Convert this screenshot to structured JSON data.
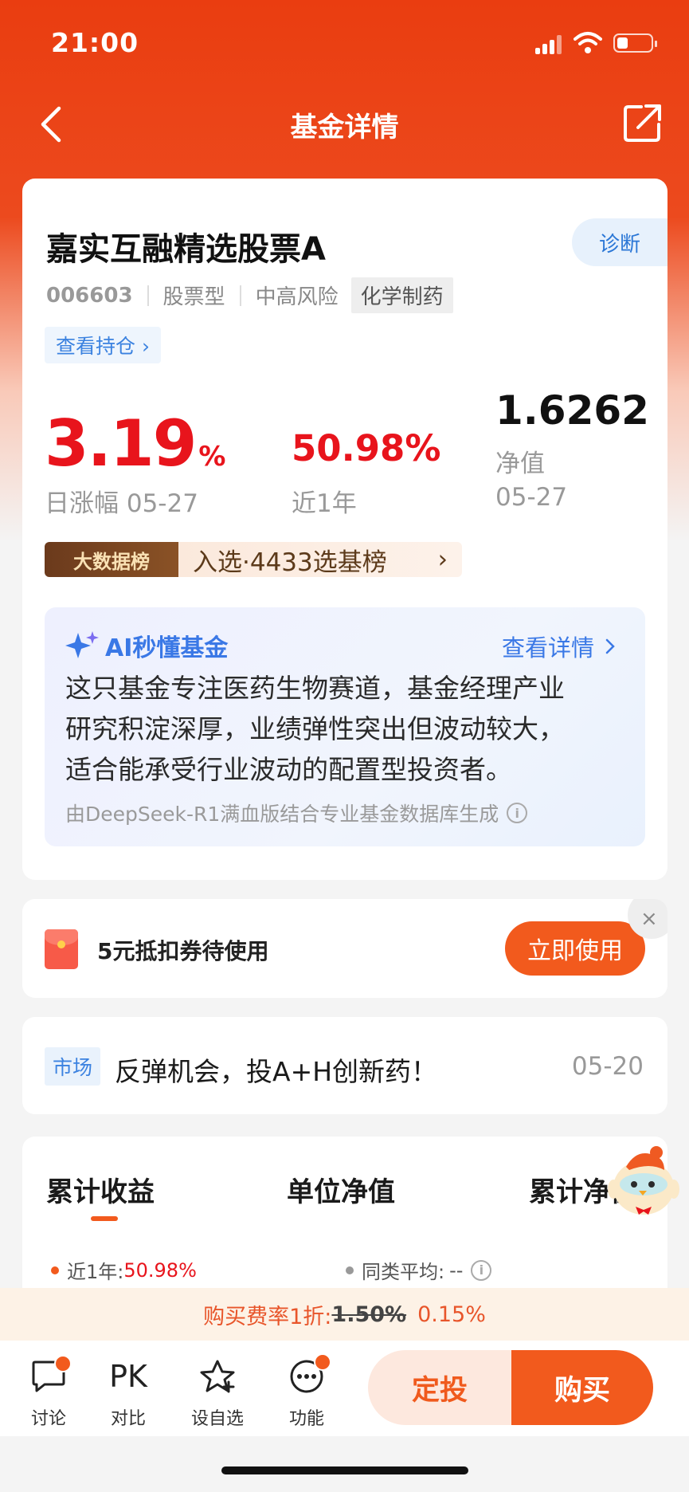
{
  "status_bar": {
    "time": "21:00"
  },
  "nav": {
    "title": "基金详情"
  },
  "fund": {
    "name": "嘉实互融精选股票A",
    "diagnose_label": "诊断",
    "code": "006603",
    "type": "股票型",
    "risk": "中高风险",
    "industry_tag": "化学制药",
    "holdings_link": "查看持仓 ›",
    "daily_change": {
      "value": "3.19",
      "unit": "%",
      "label": "日涨幅 05-27"
    },
    "year_return": {
      "value": "50.98%",
      "label": "近1年"
    },
    "nav_value": {
      "value": "1.6262",
      "label": "净值",
      "date": "05-27"
    },
    "bigdata": {
      "badge": "大数据榜",
      "text": "入选·4433选基榜",
      "chevron": "›"
    }
  },
  "ai_panel": {
    "title": "AI秒懂基金",
    "detail_link": "查看详情",
    "lines": [
      "这只基金专注医药生物赛道，基金经理产业",
      "研究积淀深厚，业绩弹性突出但波动较大，",
      "适合能承受行业波动的配置型投资者。"
    ],
    "source": "由DeepSeek-R1满血版结合专业基金数据库生成"
  },
  "coupon": {
    "text": "5元抵扣券待使用",
    "button": "立即使用",
    "close": "×"
  },
  "news": {
    "tag": "市场",
    "title": "反弹机会，投A+H创新药！",
    "date": "05-20"
  },
  "chart_tabs": {
    "tabs": [
      "累计收益",
      "单位净值",
      "累计净值"
    ],
    "active": 0,
    "legend": [
      {
        "label": "近1年:",
        "value": "50.98%",
        "color": "#f25a1d"
      },
      {
        "label": "同类平均:",
        "value": "--",
        "color": "#999999"
      }
    ]
  },
  "fee": {
    "prefix": "购买费率1折:",
    "original": "1.50%",
    "discounted": "0.15%"
  },
  "toolbar": {
    "discuss": "讨论",
    "compare_icon": "PK",
    "compare": "对比",
    "watchlist": "设自选",
    "functions": "功能",
    "sip": "定投",
    "buy": "购买"
  },
  "colors": {
    "brand": "#f25a1d",
    "header": "#ea3d10",
    "rise": "#e8141c",
    "link": "#3b82e0"
  }
}
